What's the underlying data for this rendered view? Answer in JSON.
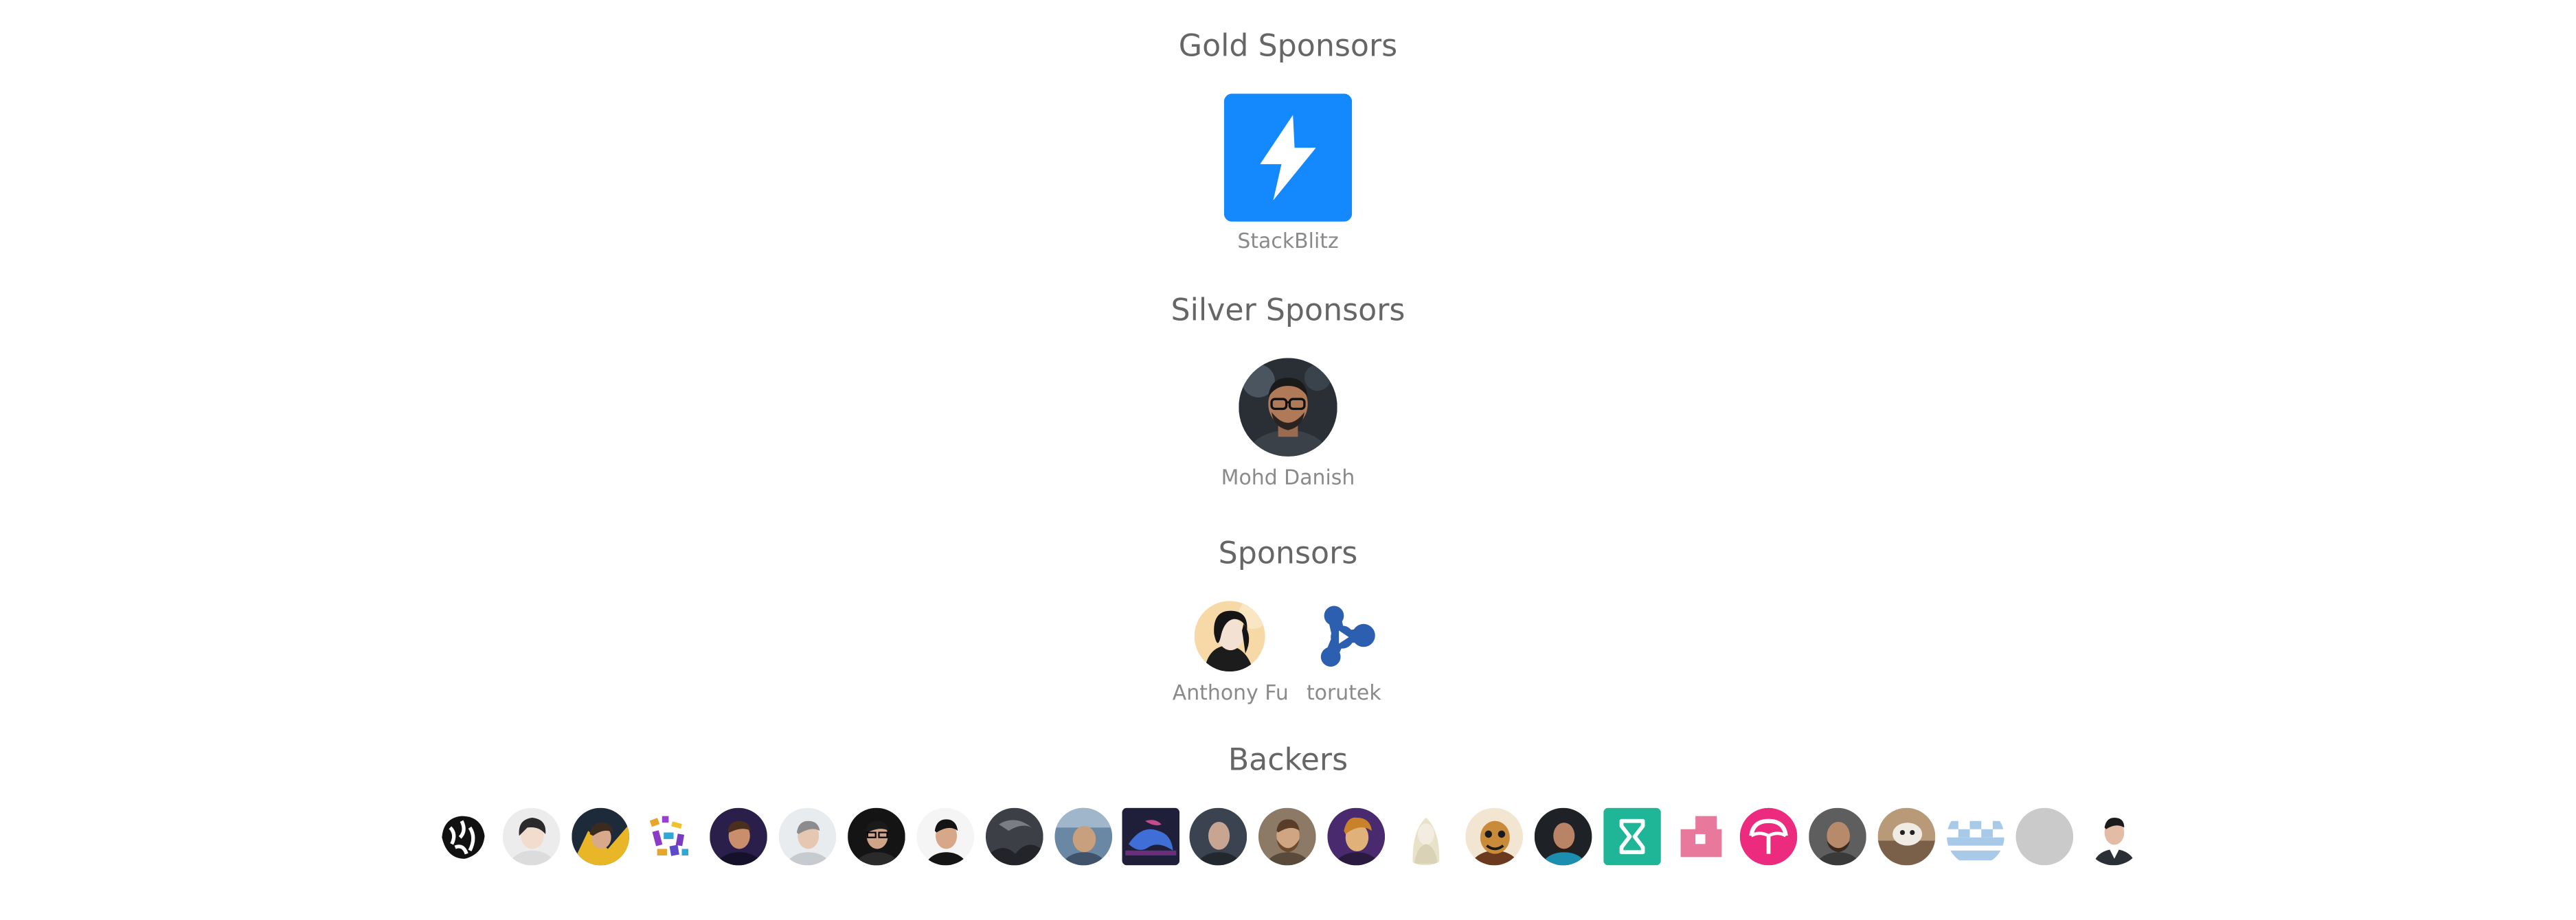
{
  "gold": {
    "heading": "Gold Sponsors",
    "sponsors": [
      {
        "name": "StackBlitz",
        "icon": "lightning-bolt-icon",
        "color": "#1389fd"
      }
    ]
  },
  "silver": {
    "heading": "Silver Sponsors",
    "sponsors": [
      {
        "name": "Mohd Danish",
        "icon": "avatar"
      }
    ]
  },
  "regular": {
    "heading": "Sponsors",
    "sponsors": [
      {
        "name": "Anthony Fu",
        "icon": "avatar"
      },
      {
        "name": "torutek",
        "icon": "torutek-logo-icon",
        "color": "#2c5fb0"
      }
    ]
  },
  "backers": {
    "heading": "Backers",
    "count": 25
  },
  "colors": {
    "heading_text": "#666666",
    "caption_text": "#8a8a8a",
    "stackblitz_blue": "#1389fd",
    "torutek_blue": "#2c5fb0"
  }
}
